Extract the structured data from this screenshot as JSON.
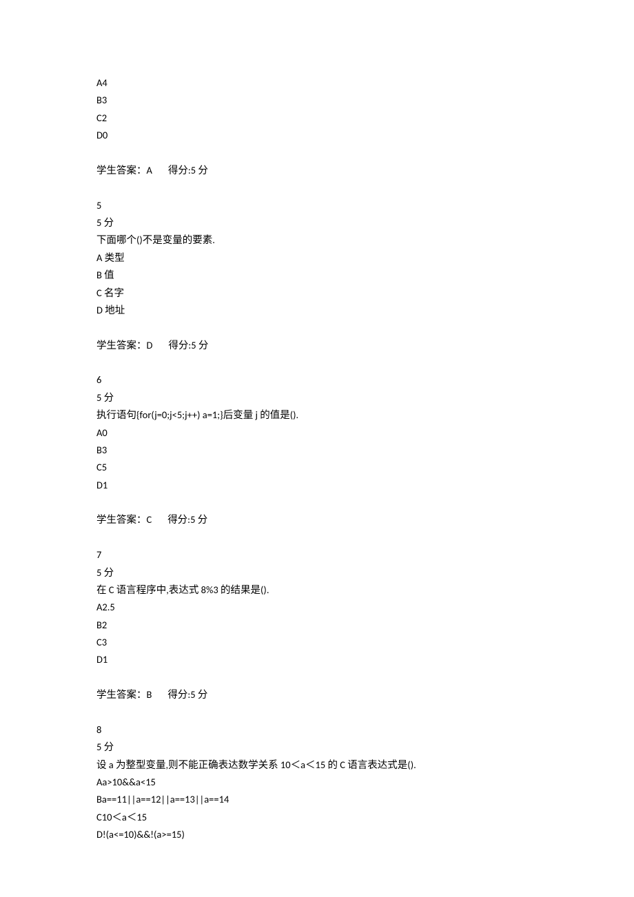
{
  "q4_tail": {
    "opts": [
      "A4",
      "B3",
      "C2",
      "D0"
    ],
    "ans_label": "学生答案：",
    "ans_val": "A",
    "gap": "       ",
    "score_label": "得分:",
    "score_val": "5 分"
  },
  "q5": {
    "num": "5",
    "pts": "5 分",
    "stem": "下面哪个()不是变量的要素.",
    "opts": [
      "A 类型",
      "B 值",
      "C 名字",
      "D 地址"
    ],
    "ans_label": "学生答案：",
    "ans_val": "D",
    "gap": "       ",
    "score_label": "得分:",
    "score_val": "5 分"
  },
  "q6": {
    "num": "6",
    "pts": "5 分",
    "stem": "执行语句{for(j=0;j<5;j++) a=1;}后变量 j 的值是().",
    "opts": [
      "A0",
      "B3",
      "C5",
      "D1"
    ],
    "ans_label": "学生答案：",
    "ans_val": "C",
    "gap": "       ",
    "score_label": "得分:",
    "score_val": "5 分"
  },
  "q7": {
    "num": "7",
    "pts": "5 分",
    "stem": "在 C 语言程序中,表达式 8%3 的结果是().",
    "opts": [
      "A2.5",
      "B2",
      "C3",
      "D1"
    ],
    "ans_label": "学生答案：",
    "ans_val": "B",
    "gap": "       ",
    "score_label": "得分:",
    "score_val": "5 分"
  },
  "q8": {
    "num": "8",
    "pts": "5 分",
    "stem": "设 a 为整型变量,则不能正确表达数学关系 10＜a＜15 的 C 语言表达式是().",
    "opts": [
      "Aa>10&&a<15",
      "Ba==11||a==12||a==13||a==14",
      "C10＜a＜15",
      "D!(a<=10)&&!(a>=15)"
    ]
  }
}
